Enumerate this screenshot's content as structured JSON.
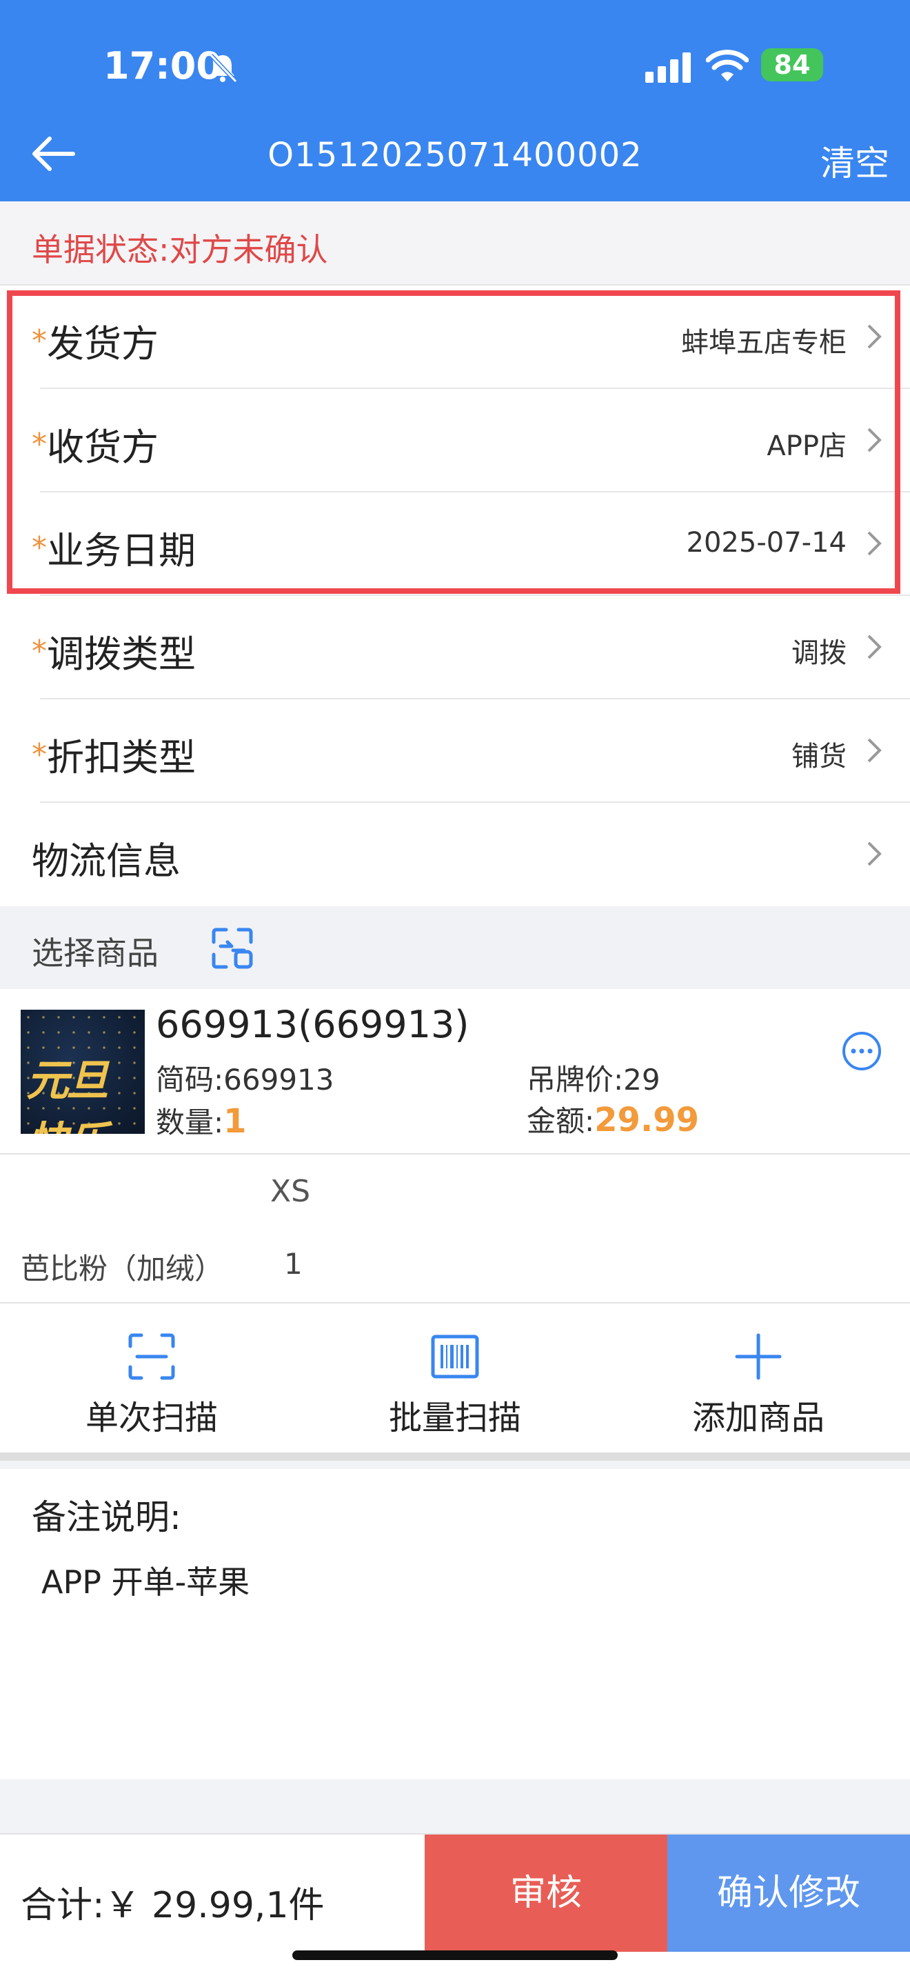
{
  "status_bar": {
    "time": "17:00",
    "battery": "84"
  },
  "nav": {
    "title": "O1512025071400002",
    "clear_label": "清空"
  },
  "doc_status": "单据状态:对方未确认",
  "form_rows": [
    {
      "label": "发货方",
      "required": "*",
      "value": "蚌埠五店专柜"
    },
    {
      "label": "收货方",
      "required": "*",
      "value": "APP店"
    },
    {
      "label": "业务日期",
      "required": "*",
      "value": "2025-07-14"
    },
    {
      "label": "调拨类型",
      "required": "*",
      "value": "调拨"
    },
    {
      "label": "折扣类型",
      "required": "*",
      "value": "铺货"
    },
    {
      "label": "物流信息",
      "required": "",
      "value": ""
    }
  ],
  "section": {
    "title": "选择商品"
  },
  "product": {
    "thumb_text": "元旦快乐",
    "name": "669913(669913)",
    "code_label": "简码:",
    "code": "669913",
    "tag_label": "吊牌价:",
    "tag_price": "29",
    "qty_label": "数量:",
    "qty": "1",
    "amount_label": "金额:",
    "amount": "29.99"
  },
  "sizes": {
    "header": "XS",
    "color": "芭比粉（加绒）",
    "qty": "1"
  },
  "actions": [
    {
      "label": "单次扫描",
      "icon": "scan-frame-icon"
    },
    {
      "label": "批量扫描",
      "icon": "barcode-icon"
    },
    {
      "label": "添加商品",
      "icon": "plus-icon"
    }
  ],
  "remark": {
    "label": "备注说明:",
    "text": "APP 开单-苹果"
  },
  "footer": {
    "total": "合计:￥ 29.99,1件",
    "audit_label": "审核",
    "confirm_label": "确认修改"
  },
  "colors": {
    "header_blue": "#3a86f0",
    "status_red": "#e04848",
    "accent_orange": "#f39a3b",
    "audit_red": "#e85e56",
    "confirm_blue": "#5f97ee",
    "highlight_red": "#f0474f"
  }
}
